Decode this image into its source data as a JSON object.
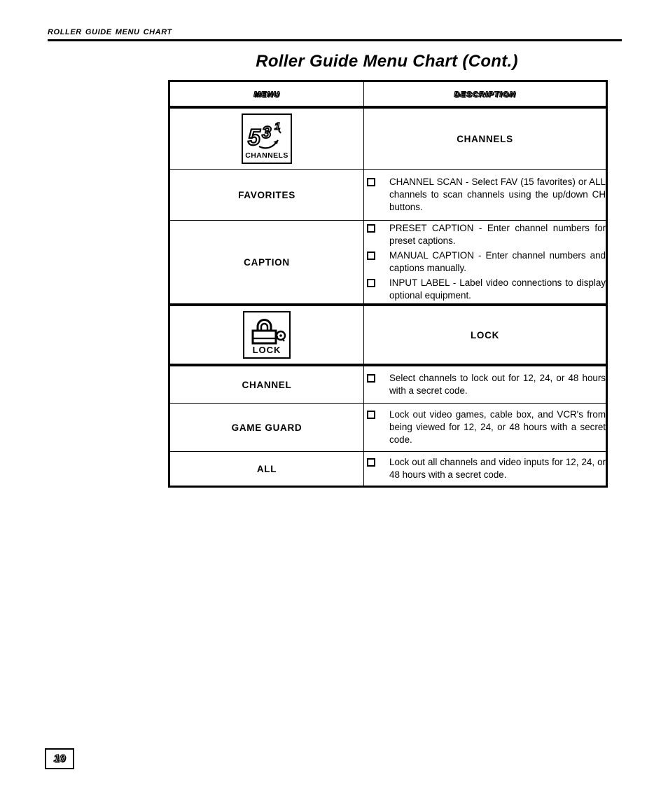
{
  "header": {
    "running_title": "Roller Guide Menu Chart"
  },
  "title": "Roller Guide Menu Chart (Cont.)",
  "table": {
    "columns": [
      "Menu",
      "Description"
    ],
    "rows": [
      {
        "menu_type": "icon",
        "menu_icon": "channels-icon",
        "menu_icon_label": "CHANNELS",
        "menu_icon_digits": [
          "5",
          "3",
          "1"
        ],
        "desc_type": "center",
        "desc_label": "CHANNELS"
      },
      {
        "menu_type": "text",
        "menu_label": "FAVORITES",
        "desc_type": "list",
        "desc_items": [
          "CHANNEL SCAN - Select FAV (15 favorites) or ALL channels to scan channels using the up/down CH buttons."
        ]
      },
      {
        "menu_type": "text",
        "menu_label": "CAPTION",
        "desc_type": "list",
        "desc_items": [
          "PRESET CAPTION - Enter channel numbers for preset captions.",
          "MANUAL CAPTION - Enter channel numbers and captions manually.",
          "INPUT LABEL - Label video connections to display optional equipment."
        ]
      },
      {
        "menu_type": "icon",
        "menu_icon": "lock-icon",
        "menu_icon_label": "LOCK",
        "desc_type": "center",
        "desc_label": "LOCK"
      },
      {
        "menu_type": "text",
        "menu_label": "CHANNEL",
        "desc_type": "list",
        "desc_items": [
          "Select channels to lock out for 12, 24, or 48 hours with a secret code."
        ]
      },
      {
        "menu_type": "text",
        "menu_label": "GAME GUARD",
        "desc_type": "list",
        "desc_items": [
          "Lock out video games, cable box, and VCR's from being viewed for 12, 24, or 48 hours with a secret code."
        ]
      },
      {
        "menu_type": "text",
        "menu_label": "ALL",
        "desc_type": "list",
        "desc_items": [
          "Lock out all channels and video inputs for 12, 24, or 48 hours with a secret code."
        ]
      }
    ]
  },
  "footer": {
    "page_number": "10"
  }
}
